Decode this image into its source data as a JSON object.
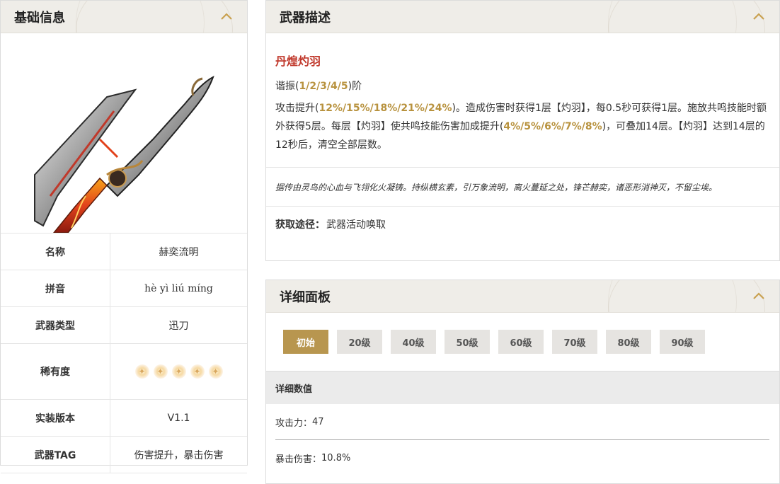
{
  "basic": {
    "title": "基础信息",
    "rows": [
      {
        "key": "名称",
        "value": "赫奕流明"
      },
      {
        "key": "拼音",
        "value": "hè yì liú míng"
      },
      {
        "key": "武器类型",
        "value": "迅刀"
      },
      {
        "key": "稀有度",
        "stars": 5
      },
      {
        "key": "实装版本",
        "value": "V1.1"
      },
      {
        "key": "武器TAG",
        "value": "伤害提升，暴击伤害"
      }
    ]
  },
  "description": {
    "title": "武器描述",
    "skill_name": "丹煌灼羽",
    "refine_prefix": "谐振(",
    "refine_values": "1/2/3/4/5",
    "refine_suffix": ")阶",
    "effect": [
      {
        "t": "攻击提升("
      },
      {
        "t": "12%/15%/18%/21%/24%",
        "hl": true
      },
      {
        "t": ")。造成伤害时获得1层【灼羽】，每0.5秒可获得1层。施放共鸣技能时额外获得5层。每层【灼羽】使共鸣技能伤害加成提升("
      },
      {
        "t": "4%/5%/6%/7%/8%",
        "hl": true
      },
      {
        "t": ")，可叠加14层。【灼羽】达到14层的12秒后，清空全部层数。"
      }
    ],
    "story": "据传由灵鸟的心血与飞翎化火凝铸。持纵横玄素，引万象流明，离火蔓延之处，锋芒赫奕，诸恶形消神灭，不留尘埃。",
    "source_label": "获取途径：",
    "source_value": "武器活动唤取"
  },
  "stats": {
    "title": "详细面板",
    "levels": [
      "初始",
      "20级",
      "40级",
      "50级",
      "60级",
      "70级",
      "80级",
      "90级"
    ],
    "active_level": 0,
    "section_title": "详细数值",
    "values": [
      {
        "label": "攻击力：",
        "value": "47"
      },
      {
        "label": "暴击伤害：",
        "value": "10.8%"
      }
    ]
  },
  "colors": {
    "accent": "#b8964f",
    "skill_name": "#c0382b",
    "highlight": "#b8923e"
  }
}
